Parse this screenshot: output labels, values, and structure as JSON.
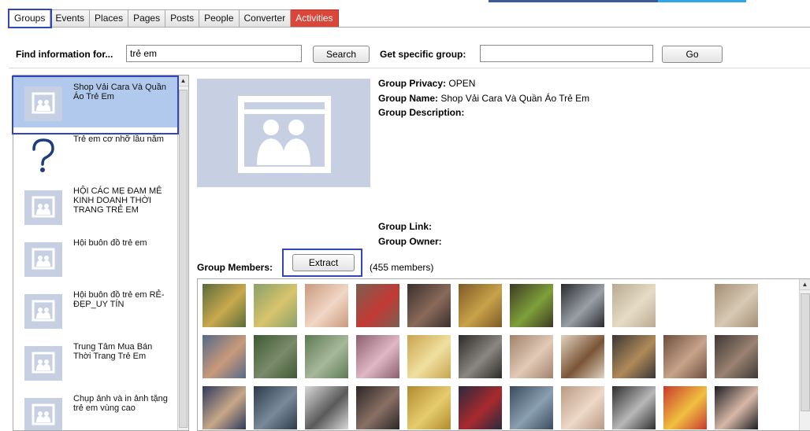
{
  "tabs": [
    {
      "label": "Groups",
      "active": true
    },
    {
      "label": "Events"
    },
    {
      "label": "Places"
    },
    {
      "label": "Pages"
    },
    {
      "label": "Posts"
    },
    {
      "label": "People"
    },
    {
      "label": "Converter"
    },
    {
      "label": "Activities",
      "accent": "#d9463a"
    }
  ],
  "search": {
    "find_label": "Find information for...",
    "query_value": "trẻ em",
    "search_button": "Search",
    "specific_label": "Get specific group:",
    "specific_value": "",
    "go_button": "Go"
  },
  "groups": [
    {
      "name": "Shop Vải Cara Và Quần Áo Trẻ Em",
      "icon": "group-placeholder-icon",
      "selected": true
    },
    {
      "name": "Trẻ em cơ nhỡ lầu năm",
      "icon": "question-mark-icon"
    },
    {
      "name": "HỘI CÁC MẸ ĐAM MÊ KINH DOANH THỜI TRANG TRẺ EM",
      "icon": "group-placeholder-icon"
    },
    {
      "name": "Hội buôn đồ trẻ em",
      "icon": "group-placeholder-icon"
    },
    {
      "name": "Hội buôn đồ trẻ em RẺ-ĐẸP_UY TÍN",
      "icon": "group-placeholder-icon"
    },
    {
      "name": "Trung Tâm Mua Bán Thời Trang Trẻ Em",
      "icon": "group-placeholder-icon"
    },
    {
      "name": "Chụp ảnh và in ảnh tặng trẻ em vùng cao",
      "icon": "group-placeholder-icon"
    }
  ],
  "details": {
    "privacy_label": "Group Privacy:",
    "privacy_value": "OPEN",
    "name_label": "Group Name:",
    "name_value": "Shop Vải Cara Và Quần Áo Trẻ Em",
    "description_label": "Group Description:",
    "link_label": "Group Link:",
    "owner_label": "Group Owner:",
    "members_label": "Group Members:",
    "extract_button": "Extract",
    "members_count": "(455 members)"
  },
  "member_colors": [
    [
      "#5b6b3a",
      "#c9a94e"
    ],
    [
      "#8aa06a",
      "#d8c46c"
    ],
    [
      "#c9997e",
      "#f1d7c6"
    ],
    [
      "#7a6050",
      "#c23a36"
    ],
    [
      "#3b2f2c",
      "#8a6a5a"
    ],
    [
      "#7c5a26",
      "#c9a24a"
    ],
    [
      "#3d3a22",
      "#7ea03a"
    ],
    [
      "#2a2a2e",
      "#9aa0a8"
    ],
    [
      "#b9aa92",
      "#e6dcc6"
    ],
    [
      "#ffffff",
      "#ffffff"
    ],
    [
      "#a48e74",
      "#d7c9b4"
    ],
    [
      "#556a8a",
      "#c99a7a"
    ],
    [
      "#3e5a34",
      "#7a8a6a"
    ],
    [
      "#5c7a52",
      "#a8b89c"
    ],
    [
      "#8a5e6e",
      "#e0b8c4"
    ],
    [
      "#c8a34e",
      "#f0e0a0"
    ],
    [
      "#2c2a28",
      "#8a8680"
    ],
    [
      "#a0826c",
      "#e2cab6"
    ],
    [
      "#e0d4c0",
      "#7a5436"
    ],
    [
      "#3a3634",
      "#b08a5a"
    ],
    [
      "#6c4e3e",
      "#c8a48a"
    ],
    [
      "#3e3834",
      "#9a8272"
    ],
    [
      "#2e3a5e",
      "#c8a888"
    ],
    [
      "#2c3a4a",
      "#7a8a9a"
    ],
    [
      "#d8d8d8",
      "#5a5a5a"
    ],
    [
      "#2a2626",
      "#8a7064"
    ],
    [
      "#b08a2e",
      "#e6cc6e"
    ],
    [
      "#2a2a3e",
      "#a82a2e"
    ],
    [
      "#3a4a5e",
      "#8aa0b0"
    ],
    [
      "#b89a84",
      "#eed8c8"
    ],
    [
      "#2e2e2e",
      "#b8b8b8"
    ],
    [
      "#c83a2e",
      "#f0c040"
    ],
    [
      "#1e1e22",
      "#d8b8a8"
    ]
  ]
}
